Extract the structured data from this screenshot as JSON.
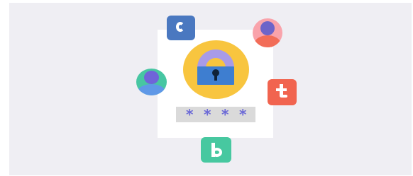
{
  "illustration": {
    "password_mask": [
      "*",
      "*",
      "*",
      "*"
    ],
    "icons": {
      "lock": "padlock-icon",
      "avatar_top_right": "user-avatar-icon",
      "avatar_left": "user-avatar-icon",
      "app_c": "letter-c-app-icon",
      "app_t": "letter-t-app-icon",
      "app_b": "letter-b-app-icon"
    },
    "colors": {
      "background": "#efeef3",
      "card": "#ffffff",
      "lock_circle": "#f8c53f",
      "lock_shackle": "#a89be8",
      "lock_body": "#3e7ed0",
      "password_field": "#dadada",
      "password_mask": "#6c6ad7",
      "app_c": "#4a78c0",
      "app_t": "#f1644f",
      "app_b": "#47c8a0",
      "avatar_top_right_bg": "#f9a3ab",
      "avatar_left_bg": "#47c6a2"
    }
  }
}
